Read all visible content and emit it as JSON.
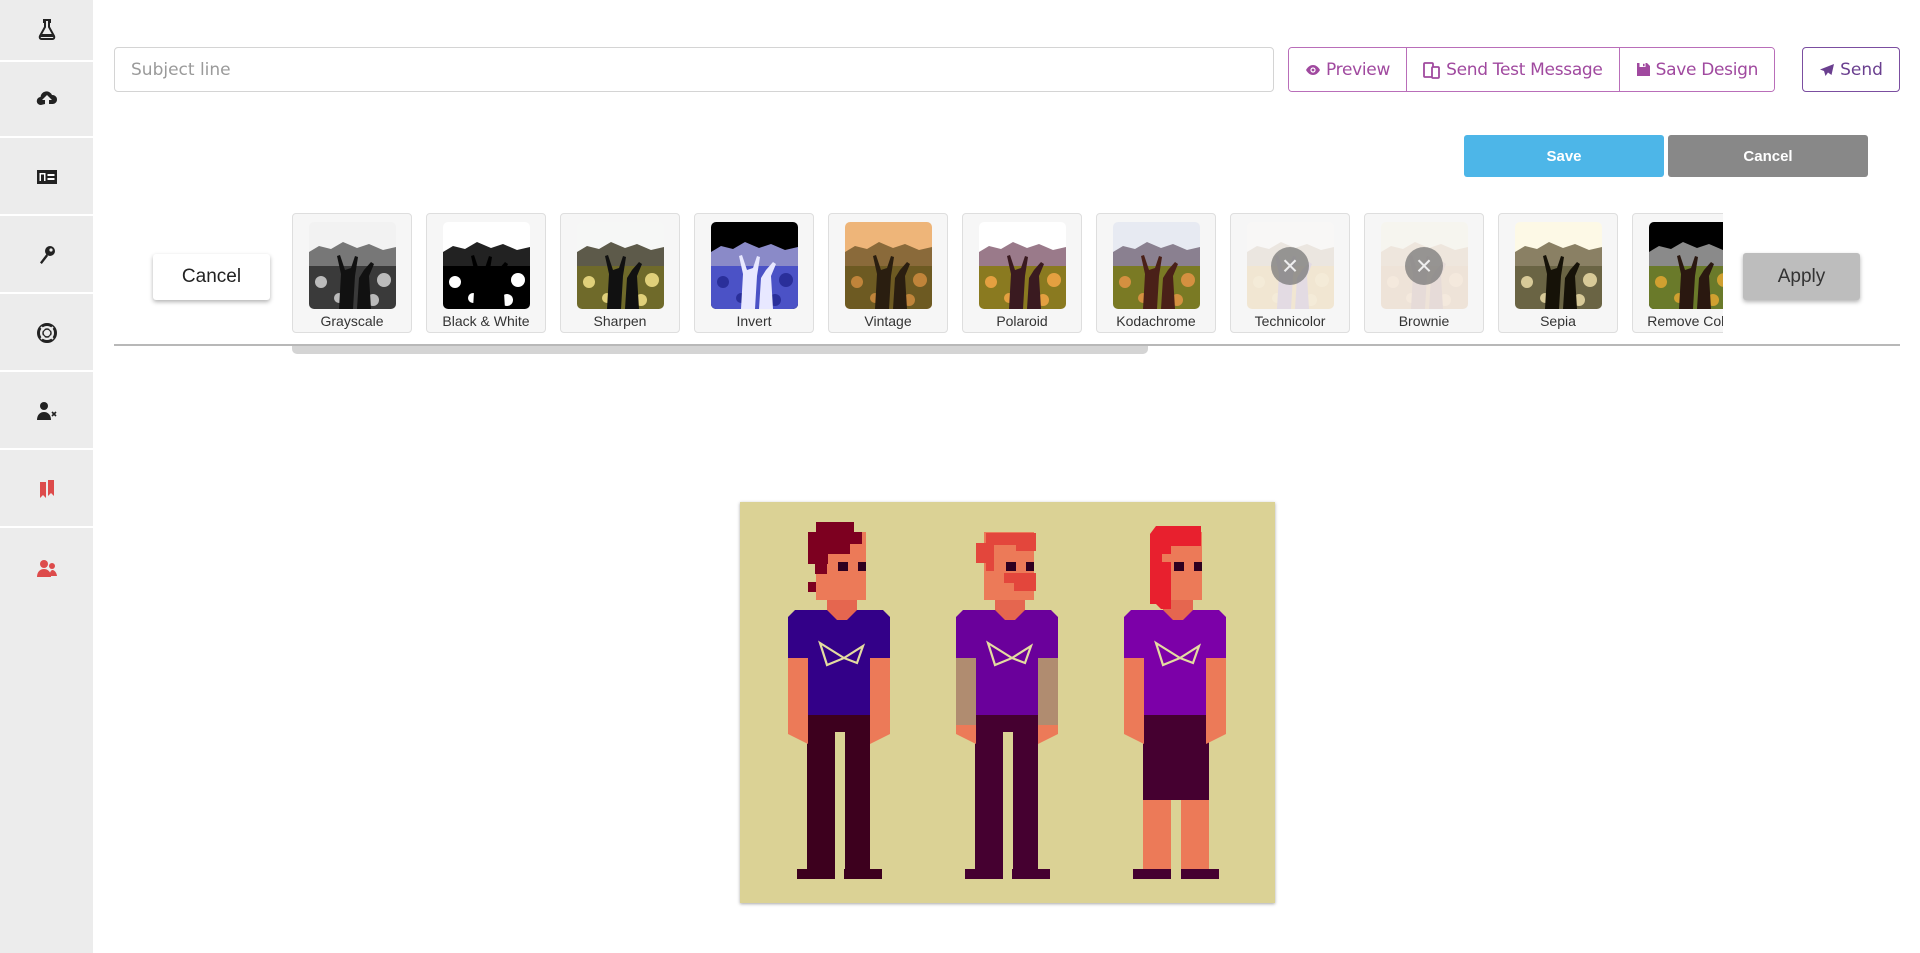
{
  "sidebar": {
    "items": [
      {
        "icon": "flask-icon",
        "color": "#222222"
      },
      {
        "icon": "cloud-upload-icon",
        "color": "#222222"
      },
      {
        "icon": "id-card-icon",
        "color": "#222222"
      },
      {
        "icon": "key-icon",
        "color": "#222222"
      },
      {
        "icon": "life-ring-icon",
        "color": "#222222"
      },
      {
        "icon": "user-remove-icon",
        "color": "#222222"
      },
      {
        "icon": "bookmarks-icon",
        "color": "#dd4b4b"
      },
      {
        "icon": "users-icon",
        "color": "#dd4b4b"
      }
    ]
  },
  "header": {
    "subject_placeholder": "Subject line",
    "subject_value": "",
    "preview_label": "Preview",
    "send_test_label": "Send Test Message",
    "save_design_label": "Save Design",
    "send_label": "Send",
    "accent_color": "#a0499f"
  },
  "editor_actions": {
    "save_label": "Save",
    "cancel_label": "Cancel",
    "save_color": "#4db6e8",
    "cancel_color": "#888888"
  },
  "filter_bar": {
    "cancel_label": "Cancel",
    "apply_label": "Apply",
    "filters": [
      {
        "label": "Grayscale",
        "style": "grayscale",
        "disabled": false
      },
      {
        "label": "Black & White",
        "style": "bw",
        "disabled": false
      },
      {
        "label": "Sharpen",
        "style": "sharpen",
        "disabled": false
      },
      {
        "label": "Invert",
        "style": "invert",
        "disabled": false
      },
      {
        "label": "Vintage",
        "style": "vintage",
        "disabled": false
      },
      {
        "label": "Polaroid",
        "style": "polaroid",
        "disabled": false
      },
      {
        "label": "Kodachrome",
        "style": "kodachrome",
        "disabled": false
      },
      {
        "label": "Technicolor",
        "style": "technicolor",
        "disabled": true
      },
      {
        "label": "Brownie",
        "style": "brownie",
        "disabled": true
      },
      {
        "label": "Sepia",
        "style": "sepia",
        "disabled": false
      },
      {
        "label": "Remove Color",
        "style": "removecolor",
        "disabled": false
      }
    ],
    "scroll_position": 0
  },
  "canvas_image": {
    "description": "Pixel art of three characters in purple t-shirts",
    "background": "#dbd295",
    "characters": [
      {
        "hair": "#7d0020",
        "skin": "#ec7a58",
        "shirt": "#330088",
        "pants": "#3d001e",
        "sleeves": "#ec7a58",
        "bottom": "pants"
      },
      {
        "hair": "#e3463c",
        "skin": "#ec7a58",
        "shirt": "#6a009b",
        "pants": "#450030",
        "sleeves": "#b08c70",
        "bottom": "pants"
      },
      {
        "hair": "#e8202e",
        "skin": "#ec7a58",
        "shirt": "#7c00a8",
        "pants": "#450030",
        "sleeves": "#ec7a58",
        "bottom": "skirt"
      }
    ]
  }
}
